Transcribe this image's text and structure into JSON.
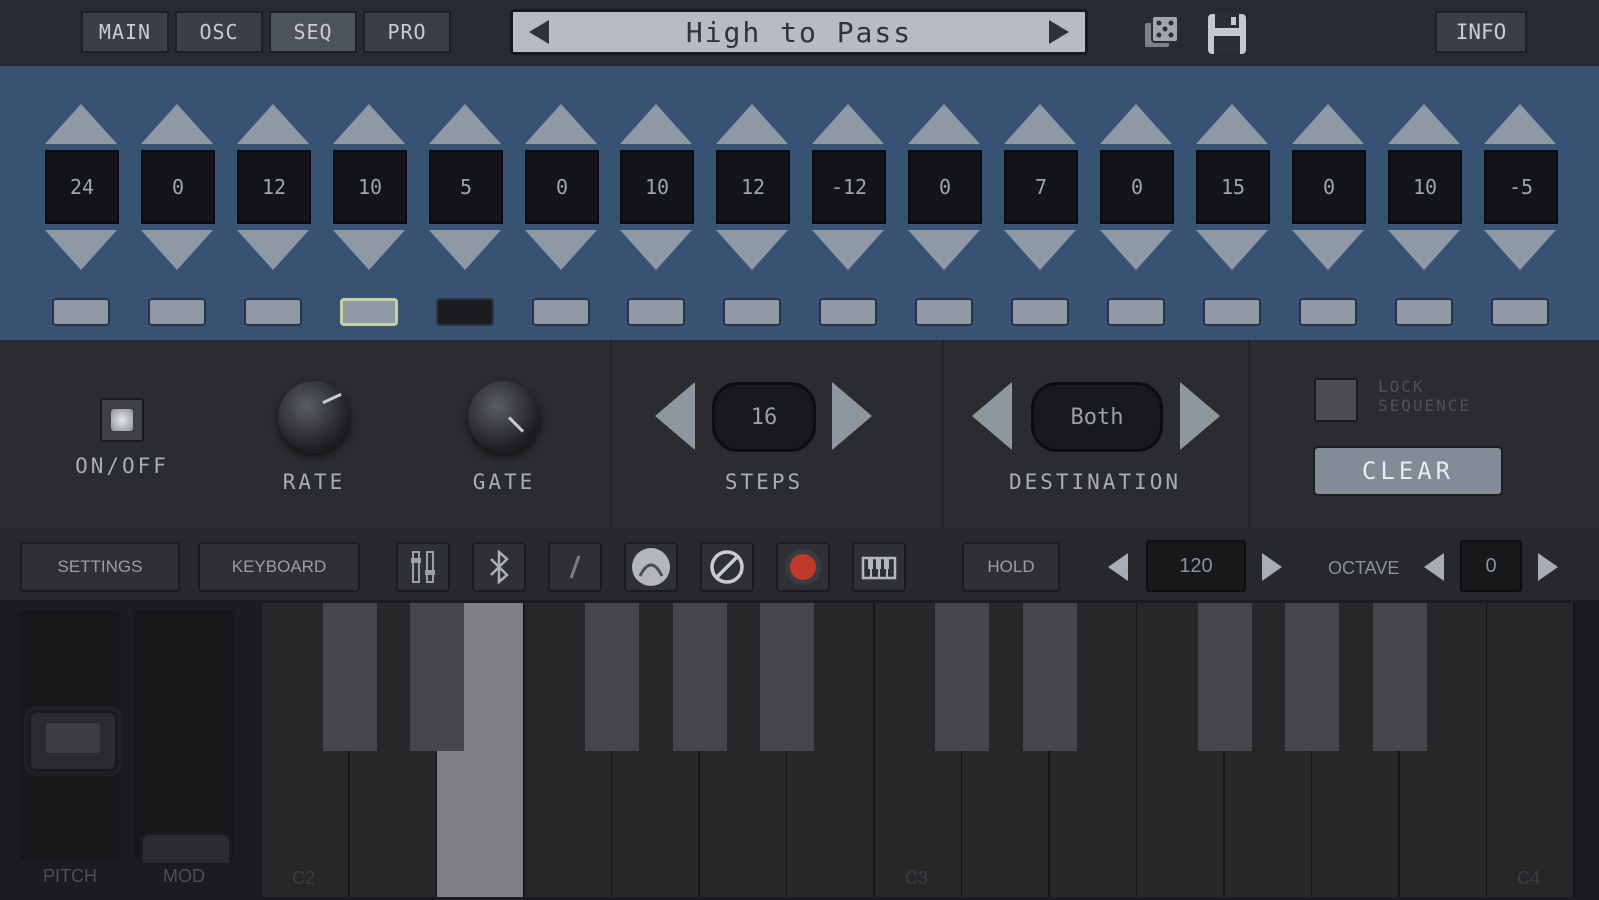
{
  "tabs": [
    {
      "label": "MAIN"
    },
    {
      "label": "OSC"
    },
    {
      "label": "SEQ",
      "active": true
    },
    {
      "label": "PRO"
    }
  ],
  "preset": {
    "name": "High to Pass"
  },
  "header": {
    "info_label": "INFO"
  },
  "sequencer": {
    "steps": [
      "24",
      "0",
      "12",
      "10",
      "5",
      "0",
      "10",
      "12",
      "-12",
      "0",
      "7",
      "0",
      "15",
      "0",
      "10",
      "-5"
    ],
    "selected_step": 4,
    "muted_step": 5
  },
  "controls": {
    "onoff_label": "ON/OFF",
    "rate_label": "RATE",
    "gate_label": "GATE",
    "steps_value": "16",
    "steps_label": "STEPS",
    "destination_value": "Both",
    "destination_label": "DESTINATION",
    "lock_label_1": "LOCK",
    "lock_label_2": "SEQUENCE",
    "clear_label": "CLEAR"
  },
  "toolbar": {
    "settings_label": "SETTINGS",
    "keyboard_label": "KEYBOARD",
    "hold_label": "HOLD",
    "tempo_value": "120",
    "octave_label": "OCTAVE",
    "octave_value": "0",
    "icons": [
      "mixer-icon",
      "bluetooth-icon",
      "glide-icon",
      "envelope-icon",
      "disable-icon",
      "record-icon",
      "keyboard-icon"
    ]
  },
  "wheels": {
    "pitch_label": "PITCH",
    "mod_label": "MOD"
  },
  "keyboard": {
    "labels": [
      "C2",
      "C3",
      "C4"
    ]
  },
  "colors": {
    "seq_bg": "#385274",
    "panel_bg": "#2b2c2f",
    "record_red": "#c0392b"
  }
}
